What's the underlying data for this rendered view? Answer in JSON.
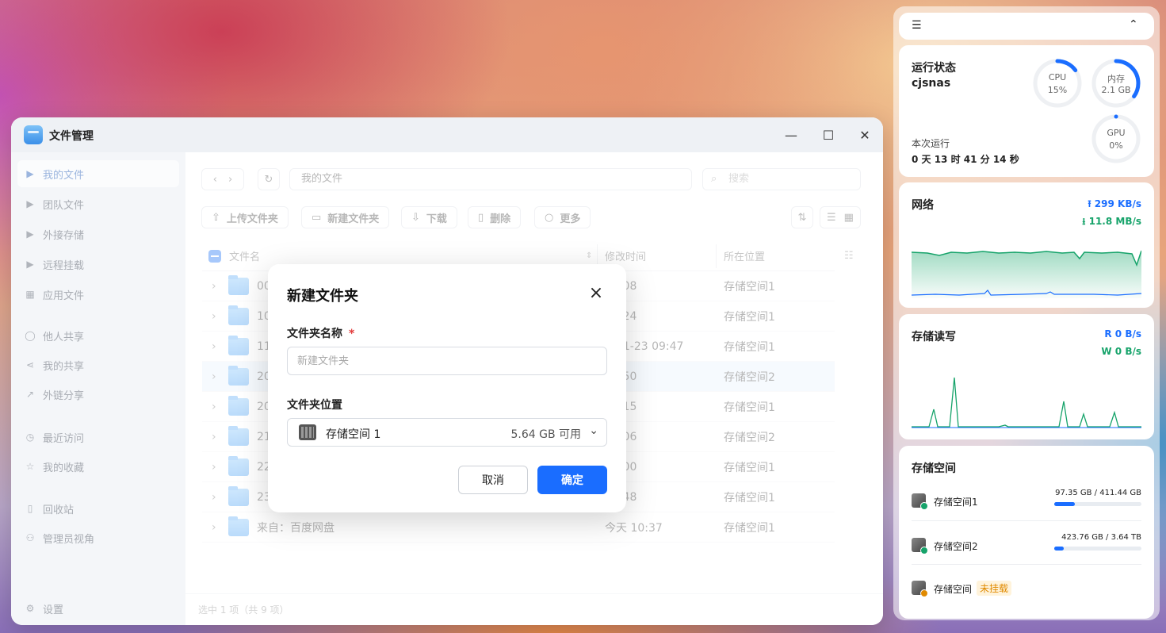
{
  "window": {
    "title": "文件管理",
    "controls": {
      "minimize": "—",
      "maximize": "☐",
      "close": "✕"
    }
  },
  "sidebar": {
    "items": [
      {
        "label": "我的文件",
        "icon": "caret-right-icon",
        "active": true
      },
      {
        "label": "团队文件",
        "icon": "caret-right-icon"
      },
      {
        "label": "外接存储",
        "icon": "caret-right-icon"
      },
      {
        "label": "远程挂载",
        "icon": "caret-right-icon"
      },
      {
        "label": "应用文件",
        "icon": "grid-icon"
      },
      {
        "label": "他人共享",
        "icon": "user-icon"
      },
      {
        "label": "我的共享",
        "icon": "share-icon"
      },
      {
        "label": "外链分享",
        "icon": "external-link-icon"
      },
      {
        "label": "最近访问",
        "icon": "clock-icon"
      },
      {
        "label": "我的收藏",
        "icon": "star-icon"
      },
      {
        "label": "回收站",
        "icon": "trash-icon"
      },
      {
        "label": "管理员视角",
        "icon": "admin-icon"
      }
    ],
    "settings": "设置"
  },
  "toolbar": {
    "path": "我的文件",
    "search_placeholder": "搜索",
    "buttons": {
      "upload": "上传文件夹",
      "new_folder": "新建文件夹",
      "download": "下载",
      "delete": "删除",
      "more": "更多"
    }
  },
  "table": {
    "columns": {
      "name": "文件名",
      "modified": "修改时间",
      "location": "所在位置"
    },
    "rows": [
      {
        "name": "00",
        "time": "12:08",
        "loc": "存储空间1"
      },
      {
        "name": "10",
        "time": "10:24",
        "loc": "存储空间1"
      },
      {
        "name": "11",
        "time": "5-01-23 09:47",
        "loc": "存储空间1"
      },
      {
        "name": "20",
        "time": "09:50",
        "loc": "存储空间2",
        "selected": true
      },
      {
        "name": "20",
        "time": "12:15",
        "loc": "存储空间1"
      },
      {
        "name": "21",
        "time": "09:06",
        "loc": "存储空间2"
      },
      {
        "name": "22",
        "time": "09:00",
        "loc": "存储空间1"
      },
      {
        "name": "23",
        "time": "09:48",
        "loc": "存储空间1"
      },
      {
        "name": "来自：百度网盘",
        "time": "今天 10:37",
        "loc": "存储空间1"
      }
    ],
    "status": "选中 1 项（共 9 项）"
  },
  "dialog": {
    "title": "新建文件夹",
    "name_label": "文件夹名称",
    "required_mark": "*",
    "name_placeholder": "新建文件夹",
    "location_label": "文件夹位置",
    "location_name": "存储空间 1",
    "location_free": "5.64 GB 可用",
    "cancel": "取消",
    "confirm": "确定"
  },
  "widgets": {
    "header": {
      "menu_icon": "filter-list-icon",
      "collapse_icon": "chevron-up-double-icon"
    },
    "status": {
      "title": "运行状态",
      "hostname": "cjsnas",
      "uptime_label": "本次运行",
      "uptime": "0 天 13 时 41 分 14 秒",
      "cpu": {
        "label": "CPU",
        "value": "15%",
        "fraction": 0.15
      },
      "mem": {
        "label": "内存",
        "value": "2.1 GB",
        "fraction": 0.35
      },
      "gpu": {
        "label": "GPU",
        "value": "0%",
        "fraction": 0
      }
    },
    "network": {
      "title": "网络",
      "up": "299 KB/s",
      "down": "11.8 MB/s"
    },
    "disk_io": {
      "title": "存储读写",
      "read": "R 0 B/s",
      "write": "W 0 B/s"
    },
    "storage": {
      "title": "存储空间",
      "items": [
        {
          "name": "存储空间1",
          "usage": "97.35 GB / 411.44 GB",
          "fraction": 0.24
        },
        {
          "name": "存储空间2",
          "usage": "423.76 GB / 3.64 TB",
          "fraction": 0.11
        },
        {
          "name": "存储空间",
          "tag": "未挂载"
        }
      ]
    },
    "colors": {
      "accent": "#1a6dff",
      "green": "#16a36a",
      "warning": "#e08a00"
    }
  }
}
